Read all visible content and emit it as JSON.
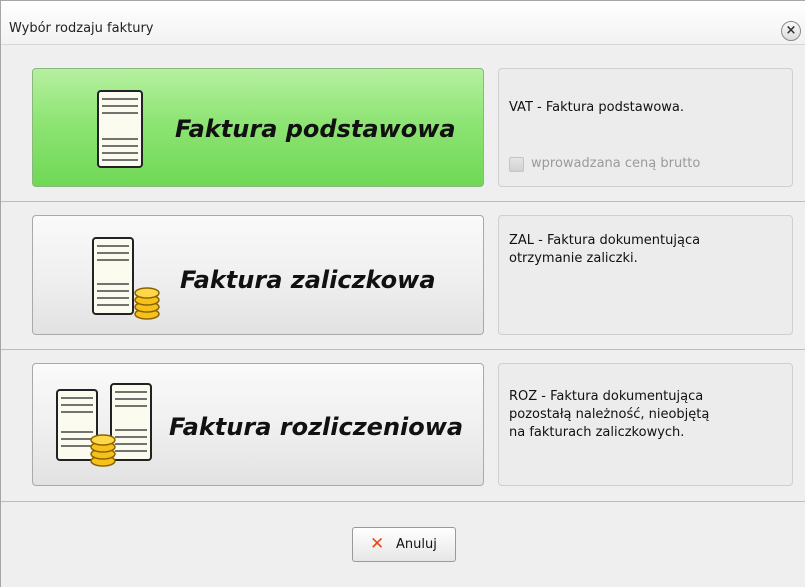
{
  "window": {
    "title": "Wybór rodzaju faktury",
    "close_glyph": "×"
  },
  "options": [
    {
      "label": "Faktura podstawowa",
      "icon": "single-invoice-icon",
      "selected": true,
      "description": [
        "VAT - Faktura podstawowa."
      ],
      "checkbox": {
        "label": "wprowadzana ceną brutto",
        "checked": false,
        "enabled": false
      }
    },
    {
      "label": "Faktura zaliczkowa",
      "icon": "invoice-with-coins-icon",
      "selected": false,
      "description": [
        "ZAL - Faktura dokumentująca",
        "otrzymanie zaliczki."
      ]
    },
    {
      "label": "Faktura rozliczeniowa",
      "icon": "two-invoices-with-coins-icon",
      "selected": false,
      "description": [
        "ROZ - Faktura dokumentująca",
        "pozostałą należność, nieobjętą",
        "na fakturach zaliczkowych."
      ]
    }
  ],
  "footer": {
    "cancel_label": "Anuluj",
    "cancel_icon": "cancel-x-icon",
    "cancel_glyph": "✕"
  },
  "colors": {
    "selected_green": "#8ee474",
    "cancel_red": "#e8491b",
    "dialog_bg": "#efefef"
  }
}
